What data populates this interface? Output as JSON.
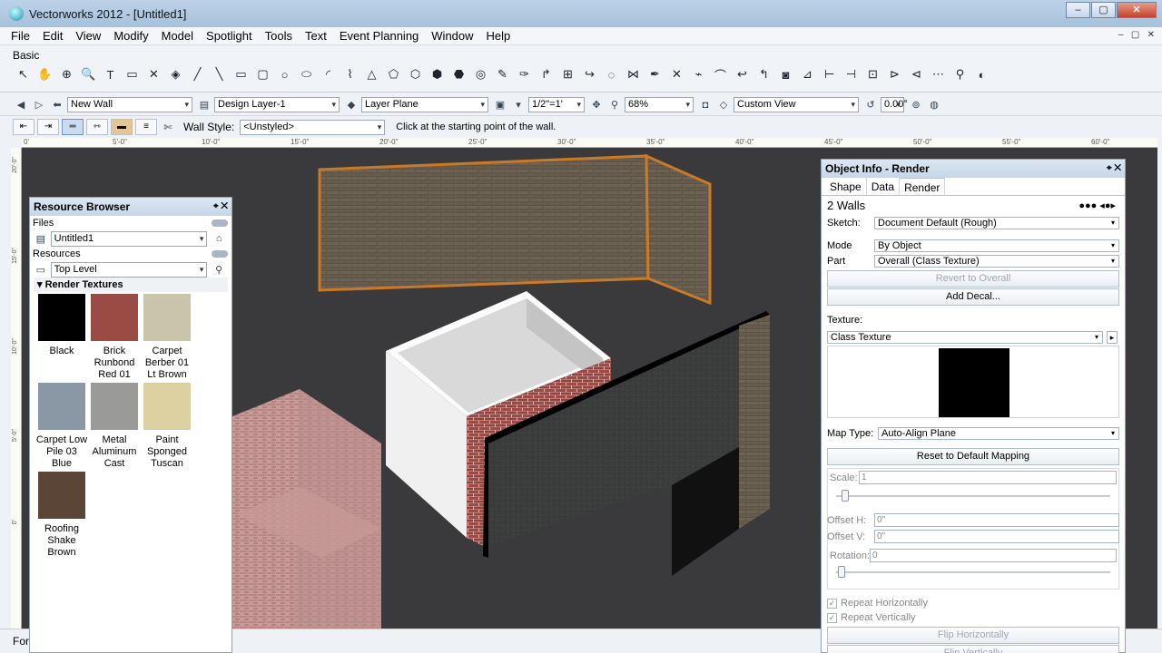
{
  "window": {
    "title": "Vectorworks 2012 - [Untitled1]",
    "controls": [
      "‒",
      "▢",
      "✕"
    ]
  },
  "menu": [
    "File",
    "Edit",
    "View",
    "Modify",
    "Model",
    "Spotlight",
    "Tools",
    "Text",
    "Event Planning",
    "Window",
    "Help"
  ],
  "mdi_controls": [
    "‒",
    "▢",
    "✕"
  ],
  "basic": {
    "label": "Basic",
    "tools": [
      "↖",
      "✋",
      "⊕",
      "🔍",
      "T",
      "▭",
      "✕",
      "◈",
      "╱",
      "╲",
      "▭",
      "▢",
      "○",
      "⬭",
      "◜",
      "⌇",
      "△",
      "⬠",
      "⬡",
      "⬢",
      "⬣",
      "◎",
      "✎",
      "✑",
      "↱",
      "⊞",
      "↪",
      "◌",
      "⋈",
      "✒",
      "✕",
      "⌁",
      "⌒",
      "↩",
      "↰",
      "◙",
      "⊿",
      "⊢",
      "⊣",
      "⊡",
      "⊳",
      "⊲",
      "⋯",
      "⚲",
      "◐"
    ]
  },
  "modebar": {
    "class": "New Wall",
    "layer": "Design Layer-1",
    "plane": "Layer Plane",
    "scale": "1/2\"=1'",
    "zoom": "68%",
    "view": "Custom View",
    "angle": "0.00°"
  },
  "wallbar": {
    "label": "Wall Style:",
    "style": "<Unstyled>",
    "hint": "Click at the starting point of the wall."
  },
  "ruler_h": [
    "0'",
    "5'-0\"",
    "10'-0\"",
    "15'-0\"",
    "20'-0\"",
    "25'-0\"",
    "30'-0\"",
    "35'-0\"",
    "40'-0\"",
    "45'-0\"",
    "50'-0\"",
    "55'-0\"",
    "60'-0\""
  ],
  "ruler_v": [
    "20'-0\"",
    "15'-0\"",
    "10'-0\"",
    "5'-0\"",
    "0'"
  ],
  "status": {
    "text": "For"
  },
  "resource_browser": {
    "title": "Resource Browser",
    "files_label": "Files",
    "file": "Untitled1",
    "resources_label": "Resources",
    "folder": "Top Level",
    "section": "Render Textures",
    "textures": [
      {
        "name": "Black",
        "color": "#000000"
      },
      {
        "name": "Brick Runbond Red 01",
        "color": "#9a4b44"
      },
      {
        "name": "Carpet Berber 01 Lt Brown",
        "color": "#c9c5ad"
      },
      {
        "name": "Carpet Low Pile 03 Blue",
        "color": "#8a98a6"
      },
      {
        "name": "Metal Aluminum Cast",
        "color": "#9a9a98"
      },
      {
        "name": "Paint Sponged Tuscan",
        "color": "#ddd1a2"
      },
      {
        "name": "Roofing Shake Brown",
        "color": "#5a4537"
      }
    ]
  },
  "object_info": {
    "title": "Object Info - Render",
    "tabs": [
      "Shape",
      "Data",
      "Render"
    ],
    "selection": "2 Walls",
    "sketch_label": "Sketch:",
    "sketch": "Document Default (Rough)",
    "mode_label": "Mode",
    "mode": "By Object",
    "part_label": "Part",
    "part": "Overall (Class Texture)",
    "revert_btn": "Revert to Overall",
    "add_decal_btn": "Add Decal...",
    "texture_label": "Texture:",
    "texture": "Class Texture",
    "maptype_label": "Map Type:",
    "maptype": "Auto-Align Plane",
    "reset_btn": "Reset to Default Mapping",
    "scale_label": "Scale:",
    "scale": "1",
    "offset_h_label": "Offset H:",
    "offset_h": "0\"",
    "offset_v_label": "Offset V:",
    "offset_v": "0\"",
    "rotation_label": "Rotation:",
    "rotation": "0",
    "repeat_h": "Repeat Horizontally",
    "repeat_v": "Repeat Vertically",
    "flip_h_btn": "Flip Horizontally",
    "flip_v_btn": "Flip Vertically"
  }
}
